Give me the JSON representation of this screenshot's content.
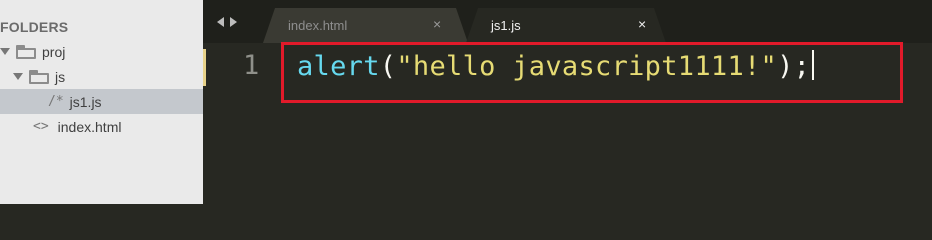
{
  "sidebar": {
    "header": "FOLDERS",
    "items": [
      {
        "label": "proj",
        "kind": "folder",
        "expanded": true
      },
      {
        "label": "js",
        "kind": "folder",
        "expanded": true
      },
      {
        "label": "js1.js",
        "kind": "file",
        "glyph": "/*",
        "selected": true
      },
      {
        "label": "index.html",
        "kind": "file",
        "glyph": "<>",
        "selected": false
      }
    ]
  },
  "tabs": [
    {
      "label": "index.html",
      "close": "×",
      "active": false
    },
    {
      "label": "js1.js",
      "close": "×",
      "active": true
    }
  ],
  "editor": {
    "line_number": "1",
    "code_tokens": {
      "fn": "alert",
      "open": "(",
      "string": "\"hello javascript1111!\"",
      "close": ");"
    }
  },
  "colors": {
    "highlight_box": "#e11a2a",
    "function": "#66d9ef",
    "string": "#e6db74",
    "background": "#272822"
  }
}
